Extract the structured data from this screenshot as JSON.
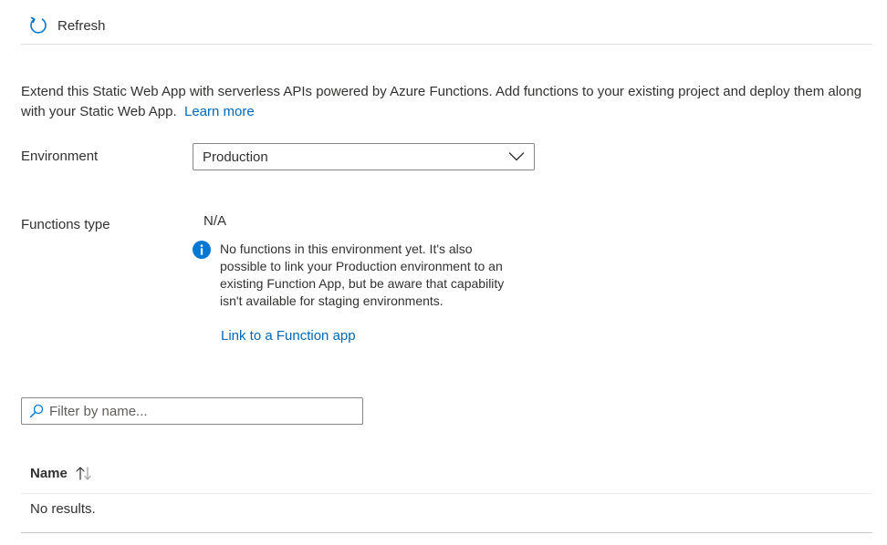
{
  "toolbar": {
    "refresh_label": "Refresh",
    "refresh_icon": "refresh-icon"
  },
  "description": {
    "text": "Extend this Static Web App with serverless APIs powered by Azure Functions. Add functions to your existing project and deploy them along with your Static Web App.",
    "link_label": "Learn more"
  },
  "environment": {
    "label": "Environment",
    "selected": "Production",
    "icon": "chevron-down-icon"
  },
  "functions_type": {
    "label": "Functions type",
    "value": "N/A"
  },
  "info": {
    "icon": "info-icon",
    "text": "No functions in this environment yet. It's also possible to link your Production environment to an existing Function App, but be aware that capability isn't available for staging environments.",
    "link_label": "Link to a Function app"
  },
  "filter": {
    "placeholder": "Filter by name...",
    "value": "",
    "icon": "search-icon"
  },
  "table": {
    "columns": [
      "Name"
    ],
    "sort_icon": "sort-icon",
    "empty_text": "No results."
  },
  "colors": {
    "accent": "#0078d4",
    "link": "#0067b8",
    "text": "#323130",
    "border": "#8a8886"
  }
}
